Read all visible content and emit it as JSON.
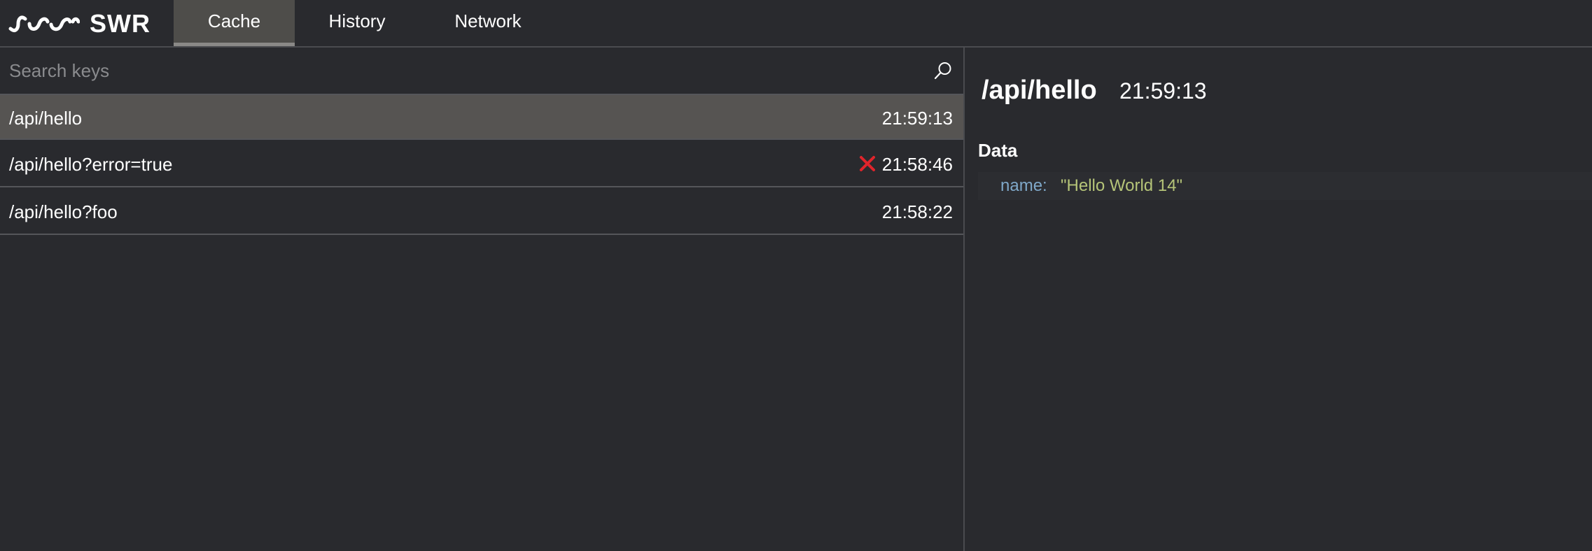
{
  "app": {
    "logo_text": "SWR"
  },
  "tabs": [
    {
      "label": "Cache",
      "active": true
    },
    {
      "label": "History",
      "active": false
    },
    {
      "label": "Network",
      "active": false
    }
  ],
  "search": {
    "placeholder": "Search keys",
    "value": ""
  },
  "cache_list": [
    {
      "key": "/api/hello",
      "time": "21:59:13",
      "error": false,
      "selected": true
    },
    {
      "key": "/api/hello?error=true",
      "time": "21:58:46",
      "error": true,
      "selected": false
    },
    {
      "key": "/api/hello?foo",
      "time": "21:58:22",
      "error": false,
      "selected": false
    }
  ],
  "detail": {
    "key": "/api/hello",
    "time": "21:59:13",
    "section_label": "Data",
    "fields": [
      {
        "name": "name:",
        "value": "\"Hello World 14\""
      }
    ]
  },
  "colors": {
    "background": "#292a2e",
    "selected_row": "#565452",
    "error": "#e0242b",
    "json_key": "#7fa8c9",
    "json_string": "#b5c478"
  }
}
